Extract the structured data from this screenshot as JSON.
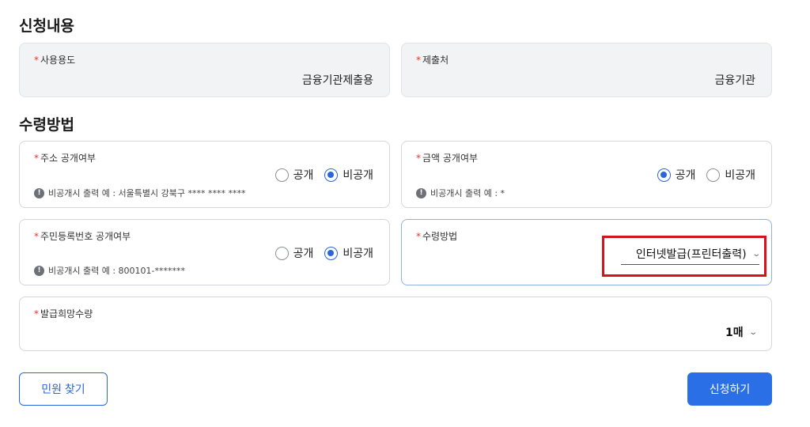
{
  "sections": {
    "application_title": "신청내용",
    "receipt_title": "수령방법"
  },
  "required_mark": "*",
  "usage": {
    "label": "사용용도",
    "value": "금융기관제출용"
  },
  "submit_to": {
    "label": "제출처",
    "value": "금융기관"
  },
  "address_disclosure": {
    "label": "주소 공개여부",
    "options": [
      "공개",
      "비공개"
    ],
    "selected": "비공개",
    "hint": "비공개시 출력 예 : 서울특별시 강북구 **** **** ****"
  },
  "amount_disclosure": {
    "label": "금액 공개여부",
    "options": [
      "공개",
      "비공개"
    ],
    "selected": "공개",
    "hint": "비공개시 출력 예 : *"
  },
  "resident_number_disclosure": {
    "label": "주민등록번호 공개여부",
    "options": [
      "공개",
      "비공개"
    ],
    "selected": "비공개",
    "hint": "비공개시 출력 예 : 800101-*******"
  },
  "receipt_method": {
    "label": "수령방법",
    "value": "인터넷발급(프린터출력)"
  },
  "copies": {
    "label": "발급희망수량",
    "value": "1매"
  },
  "buttons": {
    "find_civil": "민원 찾기",
    "apply": "신청하기"
  },
  "icons": {
    "hint": "!",
    "chevron": "⌄"
  },
  "colors": {
    "accent": "#2a66d9",
    "required": "#e5372f",
    "highlight": "#d4141a"
  }
}
